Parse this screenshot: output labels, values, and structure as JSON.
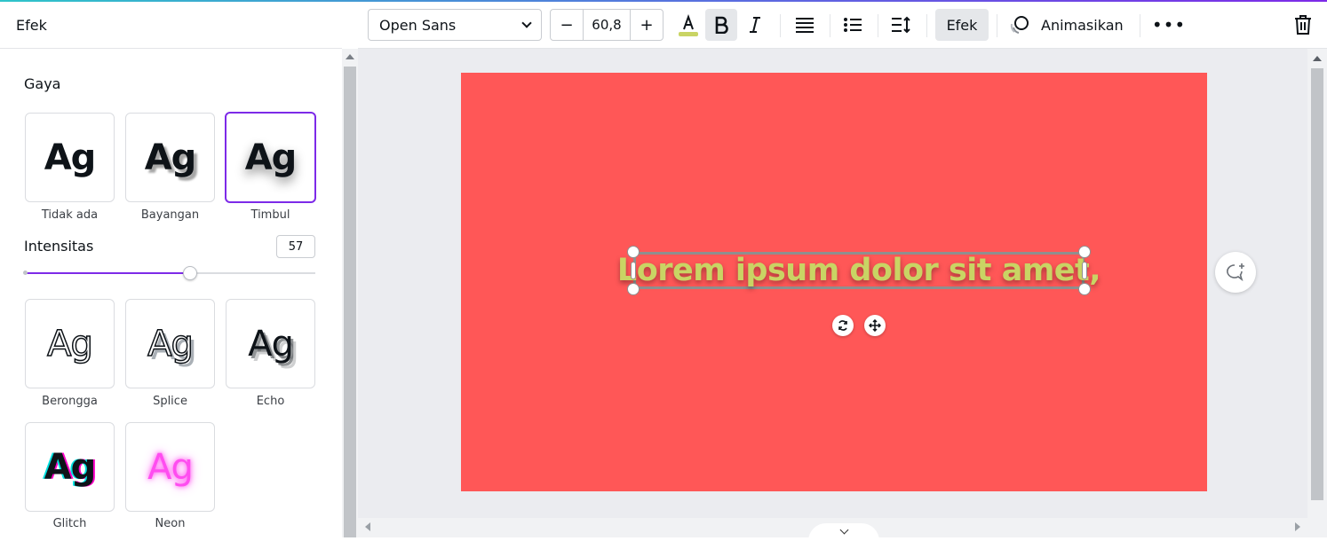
{
  "panel": {
    "title": "Efek",
    "section_title": "Gaya",
    "styles_row1": [
      {
        "label": "Tidak ada",
        "preview": "Ag",
        "icon": "style-none-preview",
        "selected": false
      },
      {
        "label": "Bayangan",
        "preview": "Ag",
        "icon": "style-shadow-preview",
        "selected": false
      },
      {
        "label": "Timbul",
        "preview": "Ag",
        "icon": "style-lift-preview",
        "selected": true
      }
    ],
    "intensity": {
      "label": "Intensitas",
      "value": "57",
      "fraction": 0.57
    },
    "styles_row2": [
      {
        "label": "Berongga",
        "preview": "Ag",
        "icon": "style-hollow-preview"
      },
      {
        "label": "Splice",
        "preview": "Ag",
        "icon": "style-splice-preview"
      },
      {
        "label": "Echo",
        "preview": "Ag",
        "icon": "style-echo-preview"
      }
    ],
    "styles_row3": [
      {
        "label": "Glitch",
        "preview": "Ag",
        "icon": "style-glitch-preview"
      },
      {
        "label": "Neon",
        "preview": "Ag",
        "icon": "style-neon-preview"
      }
    ]
  },
  "toolbar": {
    "font_family": "Open Sans",
    "font_size": "60,8",
    "decrease": "−",
    "increase": "+",
    "text_color_swatch": "#c9d464",
    "efek_label": "Efek",
    "animate_label": "Animasikan",
    "more": "•••"
  },
  "canvas": {
    "background": "#ff5757",
    "text": "Lorem ipsum dolor sit amet,",
    "text_color": "#c9d464"
  }
}
